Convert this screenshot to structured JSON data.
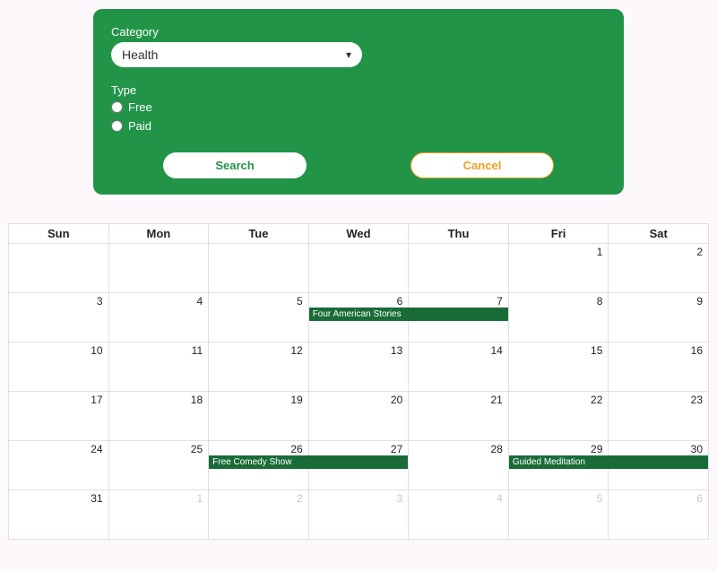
{
  "filter": {
    "category_label": "Category",
    "category_value": "Health",
    "type_label": "Type",
    "type_options": {
      "free": "Free",
      "paid": "Paid"
    },
    "search_label": "Search",
    "cancel_label": "Cancel"
  },
  "calendar": {
    "day_headers": [
      "Sun",
      "Mon",
      "Tue",
      "Wed",
      "Thu",
      "Fri",
      "Sat"
    ],
    "weeks": [
      [
        {
          "n": "",
          "muted": false
        },
        {
          "n": "",
          "muted": false
        },
        {
          "n": "",
          "muted": false
        },
        {
          "n": "",
          "muted": false
        },
        {
          "n": "",
          "muted": false
        },
        {
          "n": "1",
          "muted": false
        },
        {
          "n": "2",
          "muted": false
        }
      ],
      [
        {
          "n": "3",
          "muted": false
        },
        {
          "n": "4",
          "muted": false
        },
        {
          "n": "5",
          "muted": false
        },
        {
          "n": "6",
          "muted": false,
          "event": "Four American Stories",
          "span": 2
        },
        {
          "n": "7",
          "muted": false
        },
        {
          "n": "8",
          "muted": false
        },
        {
          "n": "9",
          "muted": false
        }
      ],
      [
        {
          "n": "10",
          "muted": false
        },
        {
          "n": "11",
          "muted": false
        },
        {
          "n": "12",
          "muted": false
        },
        {
          "n": "13",
          "muted": false
        },
        {
          "n": "14",
          "muted": false
        },
        {
          "n": "15",
          "muted": false
        },
        {
          "n": "16",
          "muted": false
        }
      ],
      [
        {
          "n": "17",
          "muted": false
        },
        {
          "n": "18",
          "muted": false
        },
        {
          "n": "19",
          "muted": false
        },
        {
          "n": "20",
          "muted": false
        },
        {
          "n": "21",
          "muted": false
        },
        {
          "n": "22",
          "muted": false
        },
        {
          "n": "23",
          "muted": false
        }
      ],
      [
        {
          "n": "24",
          "muted": false
        },
        {
          "n": "25",
          "muted": false
        },
        {
          "n": "26",
          "muted": false,
          "event": "Free Comedy Show",
          "span": 2
        },
        {
          "n": "27",
          "muted": false
        },
        {
          "n": "28",
          "muted": false
        },
        {
          "n": "29",
          "muted": false,
          "event": "Guided Meditation",
          "span": 2
        },
        {
          "n": "30",
          "muted": false
        }
      ],
      [
        {
          "n": "31",
          "muted": false
        },
        {
          "n": "1",
          "muted": true
        },
        {
          "n": "2",
          "muted": true
        },
        {
          "n": "3",
          "muted": true
        },
        {
          "n": "4",
          "muted": true
        },
        {
          "n": "5",
          "muted": true
        },
        {
          "n": "6",
          "muted": true
        }
      ]
    ]
  }
}
